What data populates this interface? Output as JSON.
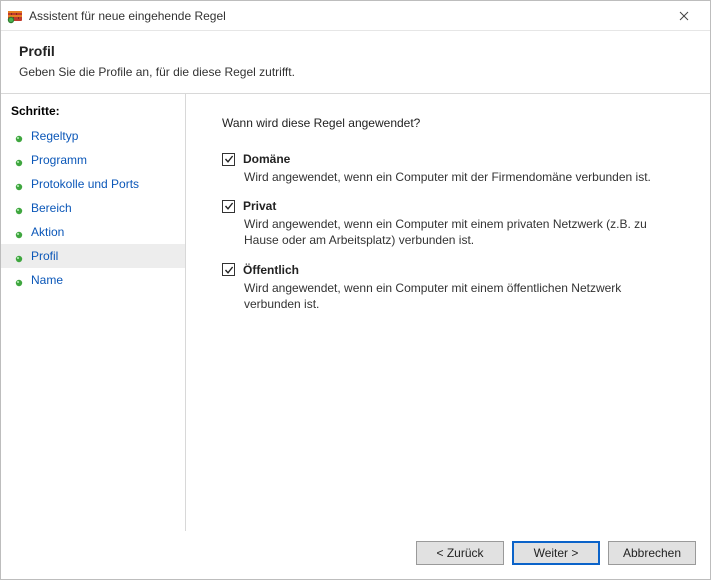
{
  "window": {
    "title": "Assistent für neue eingehende Regel"
  },
  "header": {
    "title": "Profil",
    "subtitle": "Geben Sie die Profile an, für die diese Regel zutrifft."
  },
  "sidebar": {
    "title": "Schritte:",
    "steps": [
      {
        "label": "Regeltyp"
      },
      {
        "label": "Programm"
      },
      {
        "label": "Protokolle und Ports"
      },
      {
        "label": "Bereich"
      },
      {
        "label": "Aktion"
      },
      {
        "label": "Profil"
      },
      {
        "label": "Name"
      }
    ],
    "currentIndex": 5
  },
  "content": {
    "question": "Wann wird diese Regel angewendet?",
    "profiles": [
      {
        "name": "Domäne",
        "checked": true,
        "desc": "Wird angewendet, wenn ein Computer mit der Firmendomäne verbunden ist."
      },
      {
        "name": "Privat",
        "checked": true,
        "desc": "Wird angewendet, wenn ein Computer mit einem privaten Netzwerk (z.B. zu Hause oder am Arbeitsplatz) verbunden ist."
      },
      {
        "name": "Öffentlich",
        "checked": true,
        "desc": "Wird angewendet, wenn ein Computer mit einem öffentlichen Netzwerk verbunden ist."
      }
    ]
  },
  "footer": {
    "back": "< Zurück",
    "next": "Weiter >",
    "cancel": "Abbrechen"
  },
  "colors": {
    "link": "#0b57b8",
    "accent": "#0b63c9"
  }
}
